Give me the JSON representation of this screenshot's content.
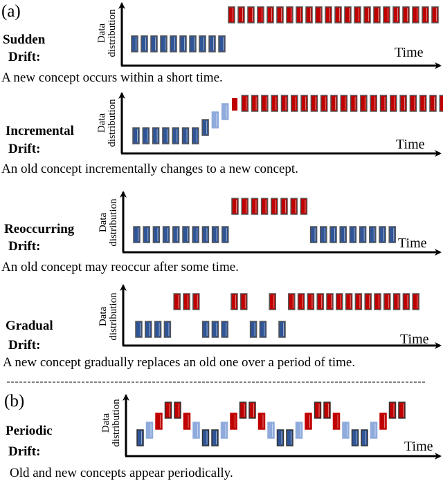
{
  "colors": {
    "old": "#2f5597",
    "new": "#c00000",
    "old_light": "#8faadc",
    "outline": "#555555"
  },
  "axis": {
    "y_label_line1": "Data",
    "y_label_line2": "distribution",
    "x_label": "Time"
  },
  "section_a": {
    "tag": "(a)"
  },
  "section_b": {
    "tag": "(b)"
  },
  "panels": [
    {
      "id": "sudden",
      "name": "Sudden",
      "suffix": "Drift:",
      "caption": "A new concept occurs within a short time.",
      "sequence": [
        "old",
        "old",
        "old",
        "old",
        "old",
        "old",
        "old",
        "old",
        "old",
        "old",
        "new",
        "new",
        "new",
        "new",
        "new",
        "new",
        "new",
        "new",
        "new",
        "new",
        "new",
        "new",
        "new",
        "new",
        "new",
        "new",
        "new",
        "new",
        "new",
        "new",
        "new",
        "new"
      ]
    },
    {
      "id": "incremental",
      "name": "Incremental",
      "suffix": "Drift:",
      "caption": "An old concept incrementally changes to a new concept.",
      "sequence": [
        "old",
        "old",
        "old",
        "old",
        "old",
        "old",
        "old",
        "step1",
        "step2",
        "step3",
        "step4",
        "new",
        "new",
        "new",
        "new",
        "new",
        "new",
        "new",
        "new",
        "new",
        "new",
        "new",
        "new",
        "new",
        "new",
        "new",
        "new",
        "new",
        "new",
        "new",
        "new",
        "new"
      ]
    },
    {
      "id": "reoccurring",
      "name": "Reoccurring",
      "suffix": "Drift:",
      "caption": "An old concept may reoccur after some time.",
      "sequence": [
        "old",
        "old",
        "old",
        "old",
        "old",
        "old",
        "old",
        "old",
        "old",
        "old",
        "new",
        "new",
        "new",
        "new",
        "new",
        "new",
        "new",
        "new",
        "old",
        "old",
        "old",
        "old",
        "old",
        "old",
        "old",
        "old",
        "old"
      ]
    },
    {
      "id": "gradual",
      "name": "Gradual",
      "suffix": "Drift:",
      "caption": "A new concept gradually replaces an old one over a period of time.",
      "sequence": [
        "old",
        "old",
        "old",
        "old",
        "new",
        "new",
        "new",
        "old",
        "old",
        "old",
        "new",
        "new",
        "old",
        "old",
        "new",
        "old",
        "new",
        "new",
        "new",
        "new",
        "new",
        "new",
        "new",
        "new",
        "new",
        "new",
        "new",
        "new",
        "new",
        "new"
      ]
    },
    {
      "id": "periodic",
      "name": "Periodic",
      "suffix": "Drift:",
      "caption": "Old and new concepts appear periodically.",
      "sequence": [
        0,
        1,
        2,
        3,
        3,
        2,
        1,
        0,
        0,
        1,
        2,
        3,
        3,
        2,
        1,
        0,
        0,
        1,
        2,
        3,
        3,
        2,
        1,
        0,
        0,
        1,
        2,
        3,
        3
      ]
    }
  ]
}
